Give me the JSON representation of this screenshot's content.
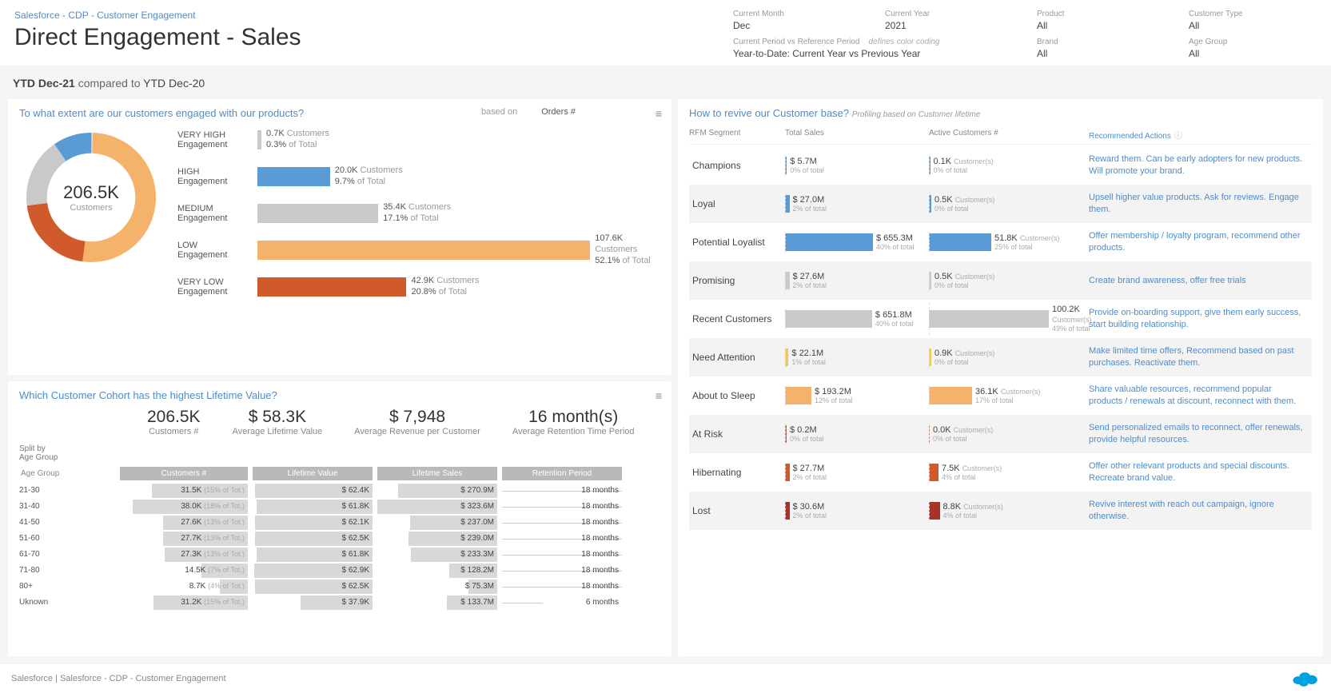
{
  "header": {
    "breadcrumb": "Salesforce - CDP - Customer Engagement",
    "title": "Direct Engagement - Sales",
    "filters": {
      "currentMonth": {
        "label": "Current Month",
        "value": "Dec"
      },
      "currentYear": {
        "label": "Current Year",
        "value": "2021"
      },
      "product": {
        "label": "Product",
        "value": "All"
      },
      "customerType": {
        "label": "Customer Type",
        "value": "All"
      },
      "period": {
        "label": "Current Period vs Reference Period",
        "note": "defines color coding",
        "value": "Year-to-Date: Current Year vs Previous Year"
      },
      "brand": {
        "label": "Brand",
        "value": "All"
      },
      "ageGroup": {
        "label": "Age Group",
        "value": "All"
      }
    }
  },
  "period": {
    "main": "YTD Dec-21",
    "compared": "compared to",
    "ref": "YTD Dec-20"
  },
  "engagement": {
    "title": "To what extent are our customers engaged with our products?",
    "basedOnLabel": "based on",
    "basedOnValue": "Orders #",
    "totalValue": "206.5K",
    "totalLabel": "Customers",
    "rows": [
      {
        "label1": "VERY HIGH",
        "label2": "Engagement",
        "count": "0.7K",
        "unit": "Customers",
        "pct": "0.3%",
        "ofTotal": "of Total",
        "color": "#c9c9c9",
        "widthPct": 1
      },
      {
        "label1": "HIGH",
        "label2": "Engagement",
        "count": "20.0K",
        "unit": "Customers",
        "pct": "9.7%",
        "ofTotal": "of Total",
        "color": "#5a9bd5",
        "widthPct": 18
      },
      {
        "label1": "MEDIUM",
        "label2": "Engagement",
        "count": "35.4K",
        "unit": "Customers",
        "pct": "17.1%",
        "ofTotal": "of Total",
        "color": "#c9c9c9",
        "widthPct": 30
      },
      {
        "label1": "LOW",
        "label2": "Engagement",
        "count": "107.6K",
        "unit": "Customers",
        "pct": "52.1%",
        "ofTotal": "of Total",
        "color": "#f5b26b",
        "widthPct": 92
      },
      {
        "label1": "VERY LOW",
        "label2": "Engagement",
        "count": "42.9K",
        "unit": "Customers",
        "pct": "20.8%",
        "ofTotal": "of Total",
        "color": "#d05a2c",
        "widthPct": 37
      }
    ]
  },
  "cohort": {
    "title": "Which Customer Cohort has the highest Lifetime Value?",
    "kpis": [
      {
        "value": "206.5K",
        "label": "Customers #"
      },
      {
        "value": "$ 58.3K",
        "label": "Average Lifetime Value"
      },
      {
        "value": "$ 7,948",
        "label": "Average Revenue per Customer"
      },
      {
        "value": "16 month(s)",
        "label": "Average Retention Time Period"
      }
    ],
    "splitBy": "Split by\nAge Group",
    "headers": {
      "age": "Age Group",
      "c": "Customers #",
      "lv": "Lifetime Value",
      "ls": "Lifetime Sales",
      "rp": "Retention Period"
    },
    "rows": [
      {
        "age": "21-30",
        "c": "31.5K",
        "cOf": "(15% of Tot.)",
        "cW": 75,
        "lv": "$ 62.4K",
        "lvW": 98,
        "ls": "$ 270.9M",
        "lsW": 83,
        "rp": "18 months",
        "rpW": 100
      },
      {
        "age": "31-40",
        "c": "38.0K",
        "cOf": "(18% of Tot.)",
        "cW": 90,
        "lv": "$ 61.8K",
        "lvW": 97,
        "ls": "$ 323.6M",
        "lsW": 100,
        "rp": "18 months",
        "rpW": 100
      },
      {
        "age": "41-50",
        "c": "27.6K",
        "cOf": "(13% of Tot.)",
        "cW": 66,
        "lv": "$ 62.1K",
        "lvW": 98,
        "ls": "$ 237.0M",
        "lsW": 73,
        "rp": "18 months",
        "rpW": 100
      },
      {
        "age": "51-60",
        "c": "27.7K",
        "cOf": "(13% of Tot.)",
        "cW": 66,
        "lv": "$ 62.5K",
        "lvW": 98,
        "ls": "$ 239.0M",
        "lsW": 74,
        "rp": "18 months",
        "rpW": 100
      },
      {
        "age": "61-70",
        "c": "27.3K",
        "cOf": "(13% of Tot.)",
        "cW": 65,
        "lv": "$ 61.8K",
        "lvW": 97,
        "ls": "$ 233.3M",
        "lsW": 72,
        "rp": "18 months",
        "rpW": 100
      },
      {
        "age": "71-80",
        "c": "14.5K",
        "cOf": "(7% of Tot.)",
        "cW": 36,
        "lv": "$ 62.9K",
        "lvW": 99,
        "ls": "$ 128.2M",
        "lsW": 40,
        "rp": "18 months",
        "rpW": 100
      },
      {
        "age": "80+",
        "c": "8.7K",
        "cOf": "(4% of Tot.)",
        "cW": 22,
        "lv": "$ 62.5K",
        "lvW": 98,
        "ls": "$ 75.3M",
        "lsW": 24,
        "rp": "18 months",
        "rpW": 100
      },
      {
        "age": "Uknown",
        "c": "31.2K",
        "cOf": "(15% of Tot.)",
        "cW": 74,
        "lv": "$ 37.9K",
        "lvW": 60,
        "ls": "$ 133.7M",
        "lsW": 42,
        "rp": "6 months",
        "rpW": 34
      }
    ]
  },
  "rfm": {
    "title": "How to revive our Customer base?",
    "subtitle": "Profiling based on Customer lifetime",
    "headers": {
      "seg": "RFM Segment",
      "sales": "Total Sales",
      "cust": "Active Customers #",
      "act": "Recommended Actions"
    },
    "rows": [
      {
        "seg": "Champions",
        "sales": "$ 5.7M",
        "salesPct": "0% of total",
        "salesW": 2,
        "cust": "0.1K",
        "custUnit": "Customer(s)",
        "custPct": "0% of total",
        "custW": 1,
        "color": "#5a9bd5",
        "action": "Reward them. Can be early adopters for new products. Will promote your brand."
      },
      {
        "seg": "Loyal",
        "sales": "$ 27.0M",
        "salesPct": "2% of total",
        "salesW": 5,
        "cust": "0.5K",
        "custUnit": "Customer(s)",
        "custPct": "0% of total",
        "custW": 2,
        "color": "#5a9bd5",
        "action": "Upsell higher value products. Ask for reviews. Engage them."
      },
      {
        "seg": "Potential Loyalist",
        "sales": "$ 655.3M",
        "salesPct": "40% of total",
        "salesW": 100,
        "cust": "51.8K",
        "custUnit": "Customer(s)",
        "custPct": "25% of total",
        "custW": 52,
        "color": "#5a9bd5",
        "action": "Offer membership / loyalty program, recommend other products."
      },
      {
        "seg": "Promising",
        "sales": "$ 27.6M",
        "salesPct": "2% of total",
        "salesW": 5,
        "cust": "0.5K",
        "custUnit": "Customer(s)",
        "custPct": "0% of total",
        "custW": 2,
        "color": "#c9c9c9",
        "action": "Create brand awareness, offer free trials"
      },
      {
        "seg": "Recent Customers",
        "sales": "$ 651.8M",
        "salesPct": "40% of total",
        "salesW": 99,
        "cust": "100.2K",
        "custUnit": "Customer(s)",
        "custPct": "49% of total",
        "custW": 100,
        "color": "#c9c9c9",
        "action": "Provide on-boarding support, give them early success, start building relationship."
      },
      {
        "seg": "Need Attention",
        "sales": "$ 22.1M",
        "salesPct": "1% of total",
        "salesW": 4,
        "cust": "0.9K",
        "custUnit": "Customer(s)",
        "custPct": "0% of total",
        "custW": 2,
        "color": "#f2c94c",
        "action": "Make limited time offers, Recommend based on past purchases. Reactivate them."
      },
      {
        "seg": "About to Sleep",
        "sales": "$ 193.2M",
        "salesPct": "12% of total",
        "salesW": 30,
        "cust": "36.1K",
        "custUnit": "Customer(s)",
        "custPct": "17% of total",
        "custW": 36,
        "color": "#f5b26b",
        "action": "Share valuable resources, recommend popular products / renewals at discount, reconnect with them."
      },
      {
        "seg": "At Risk",
        "sales": "$ 0.2M",
        "salesPct": "0% of total",
        "salesW": 1,
        "cust": "0.0K",
        "custUnit": "Customer(s)",
        "custPct": "0% of total",
        "custW": 0,
        "color": "#d05a2c",
        "action": "Send personalized emails to reconnect, offer renewals, provide helpful resources."
      },
      {
        "seg": "Hibernating",
        "sales": "$ 27.7M",
        "salesPct": "2% of total",
        "salesW": 5,
        "cust": "7.5K",
        "custUnit": "Customer(s)",
        "custPct": "4% of total",
        "custW": 8,
        "color": "#d05a2c",
        "action": "Offer other relevant products and special discounts. Recreate brand value."
      },
      {
        "seg": "Lost",
        "sales": "$ 30.6M",
        "salesPct": "2% of total",
        "salesW": 5,
        "cust": "8.8K",
        "custUnit": "Customer(s)",
        "custPct": "4% of total",
        "custW": 9,
        "color": "#a93226",
        "action": "Revive interest with reach out campaign, ignore otherwise."
      }
    ]
  },
  "footer": {
    "text": "Salesforce | Salesforce - CDP - Customer Engagement"
  },
  "chart_data": {
    "engagement_donut": {
      "type": "pie",
      "title": "Customer Engagement",
      "total": 206.5,
      "unit": "K Customers",
      "slices": [
        {
          "label": "VERY HIGH",
          "value": 0.7,
          "pct": 0.3,
          "color": "#c9c9c9"
        },
        {
          "label": "HIGH",
          "value": 20.0,
          "pct": 9.7,
          "color": "#5a9bd5"
        },
        {
          "label": "MEDIUM",
          "value": 35.4,
          "pct": 17.1,
          "color": "#c9c9c9"
        },
        {
          "label": "LOW",
          "value": 107.6,
          "pct": 52.1,
          "color": "#f5b26b"
        },
        {
          "label": "VERY LOW",
          "value": 42.9,
          "pct": 20.8,
          "color": "#d05a2c"
        }
      ]
    },
    "cohort_bars": {
      "type": "bar",
      "categories": [
        "21-30",
        "31-40",
        "41-50",
        "51-60",
        "61-70",
        "71-80",
        "80+",
        "Uknown"
      ],
      "series": [
        {
          "name": "Customers # (K)",
          "values": [
            31.5,
            38.0,
            27.6,
            27.7,
            27.3,
            14.5,
            8.7,
            31.2
          ]
        },
        {
          "name": "Lifetime Value ($K)",
          "values": [
            62.4,
            61.8,
            62.1,
            62.5,
            61.8,
            62.9,
            62.5,
            37.9
          ]
        },
        {
          "name": "Lifetime Sales ($M)",
          "values": [
            270.9,
            323.6,
            237.0,
            239.0,
            233.3,
            128.2,
            75.3,
            133.7
          ]
        },
        {
          "name": "Retention Period (months)",
          "values": [
            18,
            18,
            18,
            18,
            18,
            18,
            18,
            6
          ]
        }
      ]
    },
    "rfm_bars": {
      "type": "bar",
      "categories": [
        "Champions",
        "Loyal",
        "Potential Loyalist",
        "Promising",
        "Recent Customers",
        "Need Attention",
        "About to Sleep",
        "At Risk",
        "Hibernating",
        "Lost"
      ],
      "series": [
        {
          "name": "Total Sales ($M)",
          "values": [
            5.7,
            27.0,
            655.3,
            27.6,
            651.8,
            22.1,
            193.2,
            0.2,
            27.7,
            30.6
          ]
        },
        {
          "name": "Active Customers (K)",
          "values": [
            0.1,
            0.5,
            51.8,
            0.5,
            100.2,
            0.9,
            36.1,
            0.0,
            7.5,
            8.8
          ]
        }
      ]
    }
  }
}
